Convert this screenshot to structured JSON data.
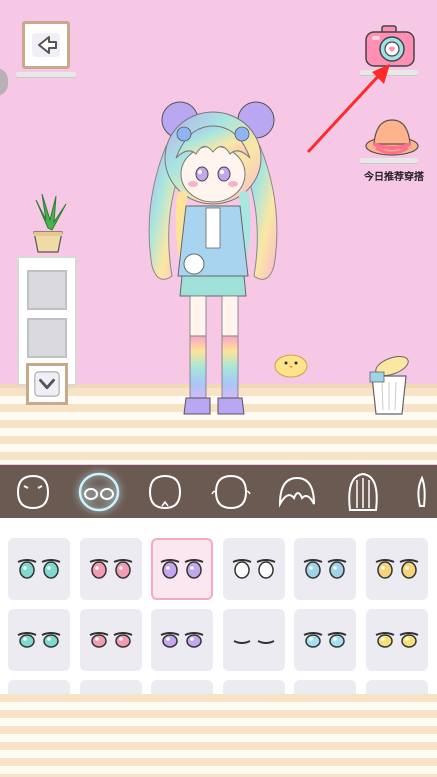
{
  "room": {
    "recommend_label": "今日推荐穿搭",
    "icons": {
      "back": "back-arrow-icon",
      "camera": "camera-icon",
      "hat": "hat-icon",
      "cabinet_toggle": "chevron-down-icon"
    }
  },
  "tabs": [
    {
      "name": "face-shape",
      "active": false
    },
    {
      "name": "eyes",
      "active": true
    },
    {
      "name": "face-outline-1",
      "active": false
    },
    {
      "name": "face-outline-2",
      "active": false
    },
    {
      "name": "bangs",
      "active": false
    },
    {
      "name": "back-hair",
      "active": false
    },
    {
      "name": "hair-accessory",
      "active": false
    }
  ],
  "eye_options": [
    {
      "color": "#7fd9cf",
      "selected": false
    },
    {
      "color": "#f29bb3",
      "selected": false
    },
    {
      "color": "#c3a6f0",
      "selected": true
    },
    {
      "color": "#ffffff",
      "selected": false
    },
    {
      "color": "#9fd3e8",
      "selected": false
    },
    {
      "color": "#f7d37a",
      "selected": false
    },
    {
      "color": "#7fd9cf",
      "selected": false
    },
    {
      "color": "#f29bb3",
      "selected": false
    },
    {
      "color": "#c3a6f0",
      "selected": false
    },
    {
      "color": "#333333",
      "selected": false
    },
    {
      "color": "#a6dff2",
      "selected": false
    },
    {
      "color": "#f7e07a",
      "selected": false
    }
  ],
  "colors": {
    "wall": "#f6c8e6",
    "tabbar": "#6b5a52",
    "selected_border": "#f4a9c4",
    "arrow": "#ff2b2b"
  }
}
